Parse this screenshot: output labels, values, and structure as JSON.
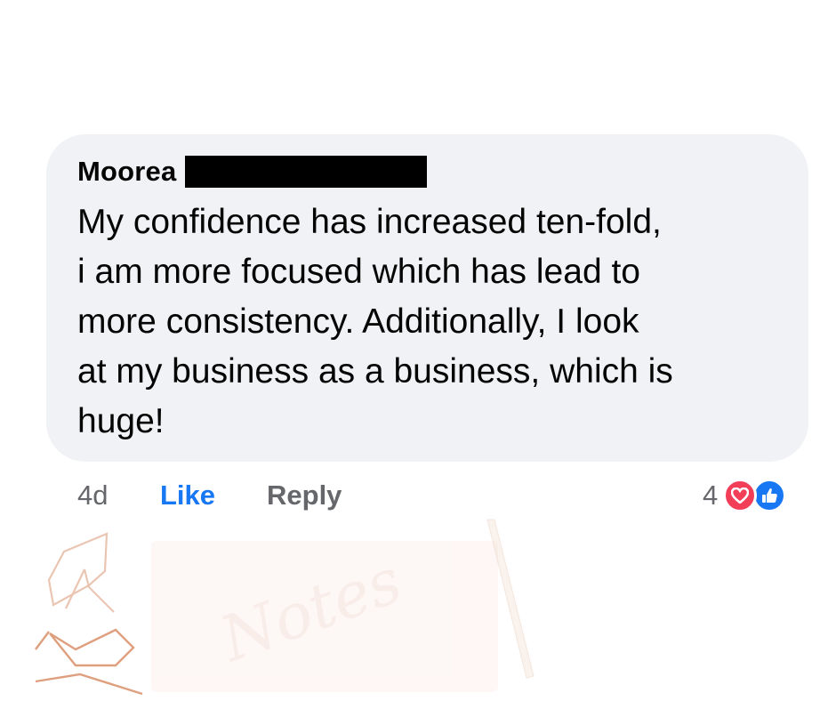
{
  "comment": {
    "author": "Moorea",
    "text_lines": [
      "My confidence has increased ten-fold,",
      "i am more focused which has lead to",
      "more consistency. Additionally, I look",
      "at my business as a business, which is",
      "huge!"
    ]
  },
  "actions": {
    "timestamp": "4d",
    "like_label": "Like",
    "reply_label": "Reply",
    "reaction_count": "4",
    "reaction_icons": [
      "heart-icon",
      "thumbs-up-icon"
    ]
  },
  "decor": {
    "notepad_lettering": "Notes"
  },
  "colors": {
    "bubble": "#f0f2f5",
    "like_blue": "#1877f2",
    "heart_red": "#f33e58",
    "muted_gray": "#65676b"
  }
}
